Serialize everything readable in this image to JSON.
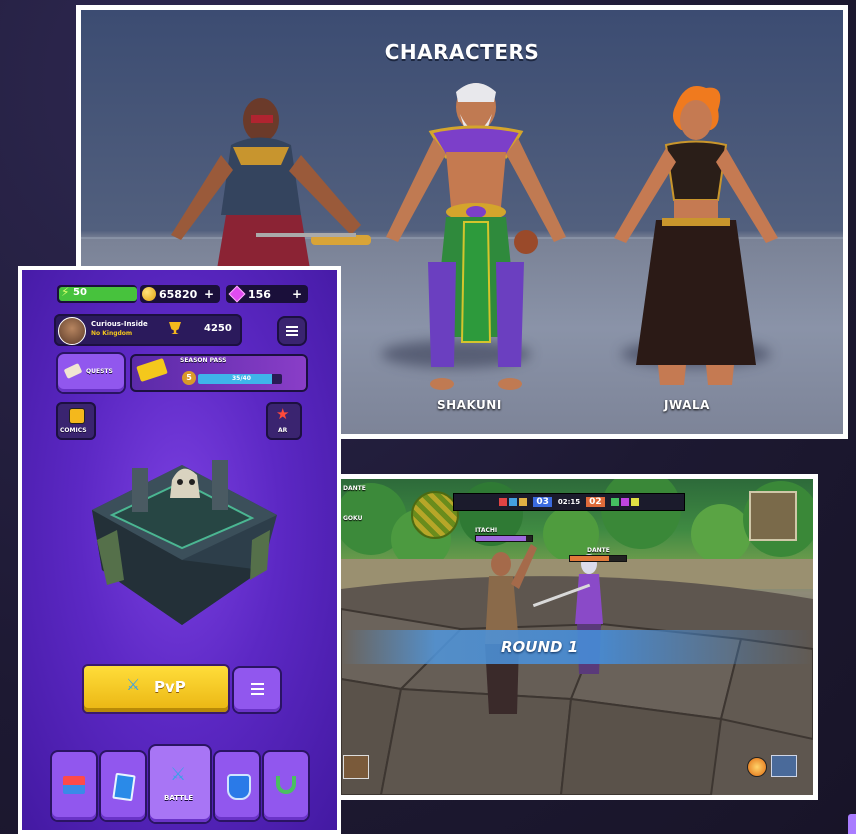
{
  "characters_panel": {
    "title": "CHARACTERS",
    "names": [
      "SHAKUNI",
      "JWALA"
    ]
  },
  "game_ui": {
    "energy": "50",
    "coins": "65820",
    "gems": "156",
    "plus": "+",
    "player": {
      "name": "Curious-Inside",
      "kingdom": "No Kingdom",
      "trophies": "4250"
    },
    "quests_label": "QUESTS",
    "season_pass": {
      "label": "SEASON PASS",
      "level": "5",
      "progress": "35/40",
      "progress_value": 0.875
    },
    "comics_label": "COMICS",
    "ar_label": "AR",
    "pvp_label": "PvP",
    "nav": {
      "battle_label": "BATTLE"
    }
  },
  "battle_panel": {
    "player_left_top": "DANTE",
    "player_left_bottom": "GOKU",
    "score_left": "03",
    "timer": "02:15",
    "score_right": "02",
    "enemy_tag": "ITACHI",
    "ally_tag": "DANTE",
    "round_label": "ROUND 1"
  },
  "colors": {
    "accent_purple": "#6a30d6",
    "pvp_yellow": "#f4c81c",
    "energy_green": "#47c23d",
    "round_blue": "#4a8fd8"
  }
}
